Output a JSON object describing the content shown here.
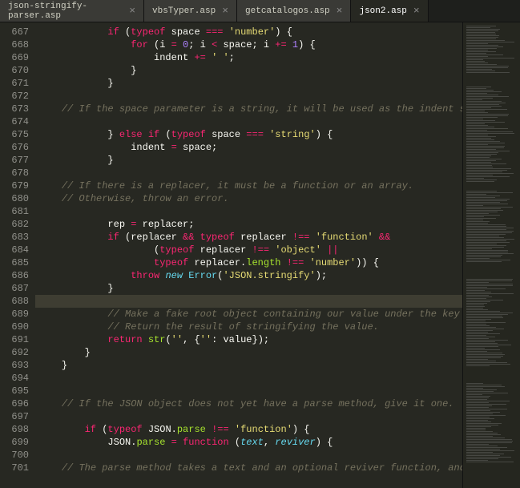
{
  "tabs": {
    "items": [
      {
        "label": "json-stringify-parser.asp",
        "active": false
      },
      {
        "label": "vbsTyper.asp",
        "active": false
      },
      {
        "label": "getcatalogos.asp",
        "active": false
      },
      {
        "label": "json2.asp",
        "active": true
      }
    ],
    "close_glyph": "×"
  },
  "gutter": {
    "start": 667,
    "end": 701,
    "highlighted": 688
  },
  "code": {
    "667": [
      [
        "kw",
        "if"
      ],
      [
        "id",
        " ("
      ],
      [
        "kw",
        "typeof"
      ],
      [
        "id",
        " space "
      ],
      [
        "op",
        "==="
      ],
      [
        "id",
        " "
      ],
      [
        "str",
        "'number'"
      ],
      [
        "id",
        ") {"
      ]
    ],
    "668": [
      [
        "kw",
        "for"
      ],
      [
        "id",
        " (i "
      ],
      [
        "op",
        "="
      ],
      [
        "id",
        " "
      ],
      [
        "num",
        "0"
      ],
      [
        "id",
        "; i "
      ],
      [
        "op",
        "<"
      ],
      [
        "id",
        " space; i "
      ],
      [
        "op",
        "+="
      ],
      [
        "id",
        " "
      ],
      [
        "num",
        "1"
      ],
      [
        "id",
        ") {"
      ]
    ],
    "669": [
      [
        "id",
        "indent "
      ],
      [
        "op",
        "+="
      ],
      [
        "id",
        " "
      ],
      [
        "str",
        "' '"
      ],
      [
        "id",
        ";"
      ]
    ],
    "670": [
      [
        "id",
        "}"
      ]
    ],
    "671": [
      [
        "id",
        "}"
      ]
    ],
    "672": [],
    "673": [
      [
        "cmt",
        "// If the space parameter is a string, it will be used as the indent string."
      ]
    ],
    "674": [],
    "675": [
      [
        "id",
        "} "
      ],
      [
        "kw",
        "else if"
      ],
      [
        "id",
        " ("
      ],
      [
        "kw",
        "typeof"
      ],
      [
        "id",
        " space "
      ],
      [
        "op",
        "==="
      ],
      [
        "id",
        " "
      ],
      [
        "str",
        "'string'"
      ],
      [
        "id",
        ") {"
      ]
    ],
    "676": [
      [
        "id",
        "indent "
      ],
      [
        "op",
        "="
      ],
      [
        "id",
        " space;"
      ]
    ],
    "677": [
      [
        "id",
        "}"
      ]
    ],
    "678": [],
    "679": [
      [
        "cmt",
        "// If there is a replacer, it must be a function or an array."
      ]
    ],
    "680": [
      [
        "cmt",
        "// Otherwise, throw an error."
      ]
    ],
    "681": [],
    "682": [
      [
        "id",
        "rep "
      ],
      [
        "op",
        "="
      ],
      [
        "id",
        " replacer;"
      ]
    ],
    "683": [
      [
        "kw",
        "if"
      ],
      [
        "id",
        " (replacer "
      ],
      [
        "op",
        "&&"
      ],
      [
        "id",
        " "
      ],
      [
        "kw",
        "typeof"
      ],
      [
        "id",
        " replacer "
      ],
      [
        "op",
        "!=="
      ],
      [
        "id",
        " "
      ],
      [
        "str",
        "'function'"
      ],
      [
        "id",
        " "
      ],
      [
        "op",
        "&&"
      ]
    ],
    "684": [
      [
        "id",
        "("
      ],
      [
        "kw",
        "typeof"
      ],
      [
        "id",
        " replacer "
      ],
      [
        "op",
        "!=="
      ],
      [
        "id",
        " "
      ],
      [
        "str",
        "'object'"
      ],
      [
        "id",
        " "
      ],
      [
        "op",
        "||"
      ]
    ],
    "685": [
      [
        "kw",
        "typeof"
      ],
      [
        "id",
        " replacer."
      ],
      [
        "prop",
        "length"
      ],
      [
        "id",
        " "
      ],
      [
        "op",
        "!=="
      ],
      [
        "id",
        " "
      ],
      [
        "str",
        "'number'"
      ],
      [
        "id",
        ")) {"
      ]
    ],
    "686": [
      [
        "kw",
        "throw"
      ],
      [
        "id",
        " "
      ],
      [
        "new",
        "new"
      ],
      [
        "id",
        " "
      ],
      [
        "cls",
        "Error"
      ],
      [
        "id",
        "("
      ],
      [
        "str",
        "'JSON.stringify'"
      ],
      [
        "id",
        ");"
      ]
    ],
    "687": [
      [
        "id",
        "}"
      ]
    ],
    "688": [],
    "689": [
      [
        "cmt",
        "// Make a fake root object containing our value under the key of ''."
      ]
    ],
    "690": [
      [
        "cmt",
        "// Return the result of stringifying the value."
      ]
    ],
    "691": [
      [
        "kw",
        "return"
      ],
      [
        "id",
        " "
      ],
      [
        "fn",
        "str"
      ],
      [
        "id",
        "("
      ],
      [
        "str",
        "''"
      ],
      [
        "id",
        ", {"
      ],
      [
        "str",
        "''"
      ],
      [
        "id",
        ": value});"
      ]
    ],
    "692": [
      [
        "id",
        "}"
      ]
    ],
    "693": [
      [
        "id",
        "}"
      ]
    ],
    "694": [],
    "695": [],
    "696": [
      [
        "cmt",
        "// If the JSON object does not yet have a parse method, give it one."
      ]
    ],
    "697": [],
    "698": [
      [
        "kw",
        "if"
      ],
      [
        "id",
        " ("
      ],
      [
        "kw",
        "typeof"
      ],
      [
        "id",
        " JSON."
      ],
      [
        "prop",
        "parse"
      ],
      [
        "id",
        " "
      ],
      [
        "op",
        "!=="
      ],
      [
        "id",
        " "
      ],
      [
        "str",
        "'function'"
      ],
      [
        "id",
        ") {"
      ]
    ],
    "699": [
      [
        "id",
        "JSON."
      ],
      [
        "prop",
        "parse"
      ],
      [
        "id",
        " "
      ],
      [
        "op",
        "="
      ],
      [
        "id",
        " "
      ],
      [
        "kw",
        "function"
      ],
      [
        "id",
        " ("
      ],
      [
        "var",
        "text"
      ],
      [
        "id",
        ", "
      ],
      [
        "var",
        "reviver"
      ],
      [
        "id",
        ") {"
      ]
    ],
    "700": [],
    "701": [
      [
        "cmt",
        "// The parse method takes a text and an optional reviver function, and returns"
      ]
    ]
  },
  "indent": {
    "667": 12,
    "668": 16,
    "669": 20,
    "670": 16,
    "671": 12,
    "672": 0,
    "673": 4,
    "674": 0,
    "675": 12,
    "676": 16,
    "677": 12,
    "678": 0,
    "679": 4,
    "680": 4,
    "681": 0,
    "682": 12,
    "683": 12,
    "684": 20,
    "685": 20,
    "686": 16,
    "687": 12,
    "688": 0,
    "689": 12,
    "690": 12,
    "691": 12,
    "692": 8,
    "693": 4,
    "694": 0,
    "695": 0,
    "696": 4,
    "697": 0,
    "698": 8,
    "699": 12,
    "700": 0,
    "701": 4
  }
}
